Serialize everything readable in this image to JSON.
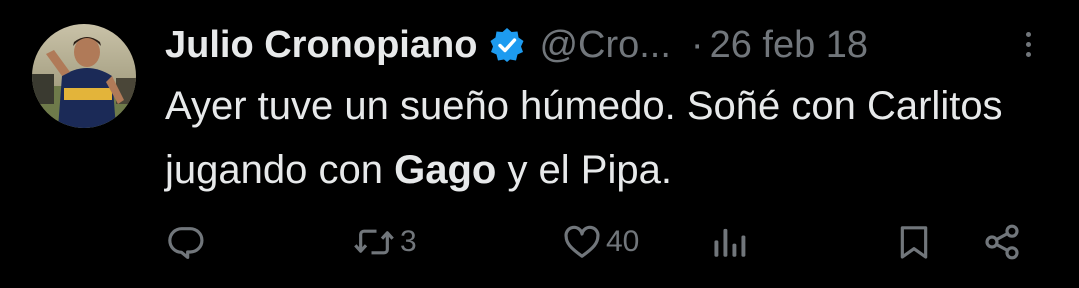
{
  "tweet": {
    "display_name": "Julio Cronopiano",
    "handle": "@Cro...",
    "separator": "·",
    "date": "26 feb 18",
    "text_part1": "Ayer tuve un sueño húmedo. Soñé con Carlitos jugando con ",
    "text_bold": "Gago",
    "text_part2": " y el Pipa."
  },
  "actions": {
    "reply_count": "",
    "retweet_count": "3",
    "like_count": "40"
  },
  "colors": {
    "background": "#000000",
    "text_primary": "#e7e9ea",
    "text_secondary": "#71767b",
    "verified_badge": "#1d9bf0"
  },
  "icons": [
    "verified-badge-icon",
    "more-icon",
    "reply-icon",
    "retweet-icon",
    "like-icon",
    "views-icon",
    "bookmark-icon",
    "share-icon"
  ]
}
